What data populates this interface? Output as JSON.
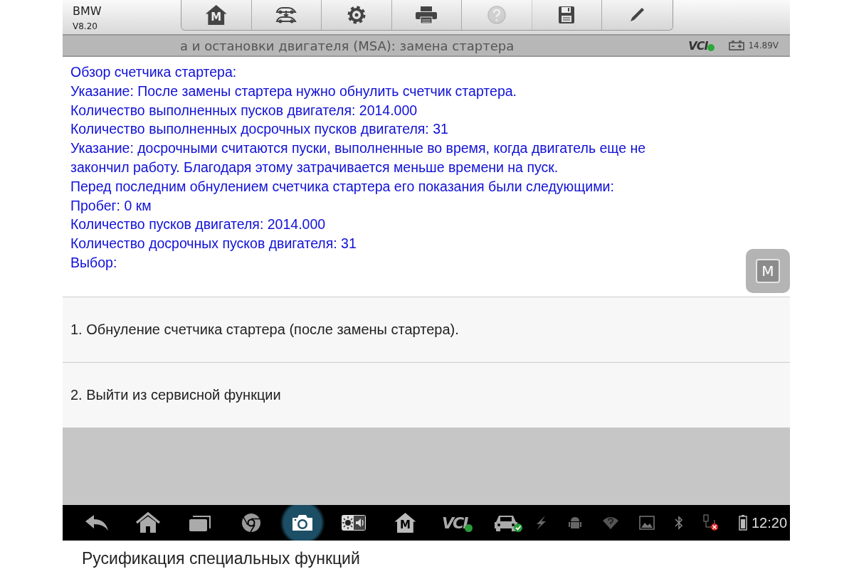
{
  "app": {
    "name": "BMW",
    "version": "V8.20"
  },
  "toolbar": [
    {
      "kind": "home",
      "letter": "M",
      "disabled": false
    },
    {
      "kind": "car-swap",
      "disabled": false
    },
    {
      "kind": "settings",
      "disabled": false
    },
    {
      "kind": "print",
      "disabled": false
    },
    {
      "kind": "help",
      "disabled": true
    },
    {
      "kind": "save",
      "disabled": false
    },
    {
      "kind": "edit",
      "disabled": false
    }
  ],
  "title_bar": {
    "title": "а и остановки двигателя (MSA): замена стартера",
    "vci": "VCI",
    "vci_connected": true,
    "voltage": "14.89V"
  },
  "message_lines": [
    "Обзор счетчика стартера:",
    "Указание: После замены стартера нужно обнулить счетчик стартера.",
    "Количество выполненных пусков двигателя: 2014.000",
    "Количество выполненных досрочных пусков двигателя: 31",
    "Указание: досрочными считаются пуски, выполненные во время, когда двигатель еще не",
    "закончил работу. Благодаря этому затрачивается меньше времени на пуск.",
    "Перед последним обнулением счетчика стартера его показания были следующими:",
    "Пробег: 0 км",
    "Количество пусков двигателя: 2014.000",
    "Количество досрочных пусков двигателя: 31",
    "Выбор:"
  ],
  "floating_button": {
    "letter": "M"
  },
  "options": [
    {
      "label": "1. Обнуление счетчика стартера (после замены стартера)."
    },
    {
      "label": "2. Выйти из сервисной функции"
    }
  ],
  "nav_bar": {
    "buttons": [
      {
        "kind": "back",
        "selected": false
      },
      {
        "kind": "home",
        "selected": false
      },
      {
        "kind": "recent",
        "selected": false
      },
      {
        "kind": "browser",
        "selected": false
      },
      {
        "kind": "camera",
        "selected": true
      },
      {
        "kind": "brightness",
        "selected": false
      },
      {
        "kind": "m-home",
        "text": "M",
        "selected": false
      },
      {
        "kind": "vci",
        "text": "VCI",
        "selected": false
      },
      {
        "kind": "car",
        "selected": false
      }
    ],
    "status_icons": [
      {
        "kind": "lightning"
      },
      {
        "kind": "android"
      },
      {
        "kind": "wifi"
      },
      {
        "kind": "image"
      },
      {
        "kind": "bluetooth"
      },
      {
        "kind": "network"
      },
      {
        "kind": "battery"
      }
    ],
    "time": "12:20"
  },
  "caption": "Русификация специальных функций"
}
